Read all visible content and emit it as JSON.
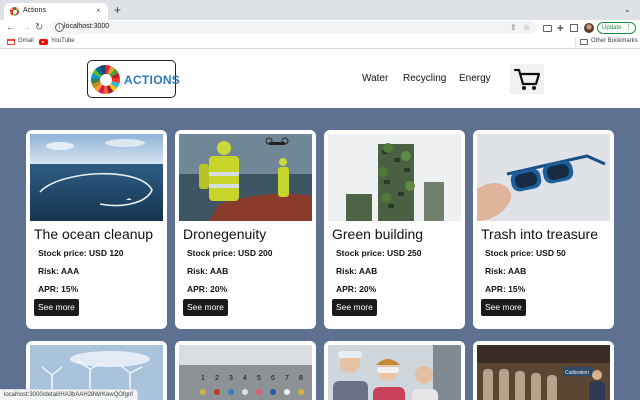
{
  "browser": {
    "tab_title": "Actions",
    "tab_close": "×",
    "new_tab": "+",
    "tab_menu": "⌄",
    "url": "localhost:3000",
    "update_label": "Update",
    "bookmarks": [
      "Gmail",
      "YouTube"
    ],
    "other_bookmarks": "Other Bookmarks",
    "status_url": "localhost:3000/detail/HA3bAAH28WrKewQOfgnf"
  },
  "site": {
    "logo_text": "ACTIONS",
    "nav": [
      "Water",
      "Recycling",
      "Energy"
    ]
  },
  "products": [
    {
      "title": "The ocean cleanup",
      "stock": "Stock price: USD 120",
      "risk": "Risk: AAA",
      "apr": "APR: 15%",
      "button": "See more"
    },
    {
      "title": "Dronegenuity",
      "stock": "Stock price: USD 200",
      "risk": "Risk: AAB",
      "apr": "APR: 20%",
      "button": "See more"
    },
    {
      "title": "Green building",
      "stock": "Stock price: USD 250",
      "risk": "Risk: AAB",
      "apr": "APR: 20%",
      "button": "See more"
    },
    {
      "title": "Trash into treasure",
      "stock": "Stock price: USD 50",
      "risk": "Risk: AAB",
      "apr": "APR: 15%",
      "button": "See more"
    }
  ],
  "row2_image_text": {
    "numbers": [
      "1",
      "2",
      "3",
      "4",
      "5",
      "6",
      "7",
      "8"
    ],
    "calibration": "Calibration"
  },
  "colors": {
    "product_area_bg": "#5f7191",
    "logo_text": "#2b7bb9",
    "button_bg": "#1b1b1b"
  }
}
